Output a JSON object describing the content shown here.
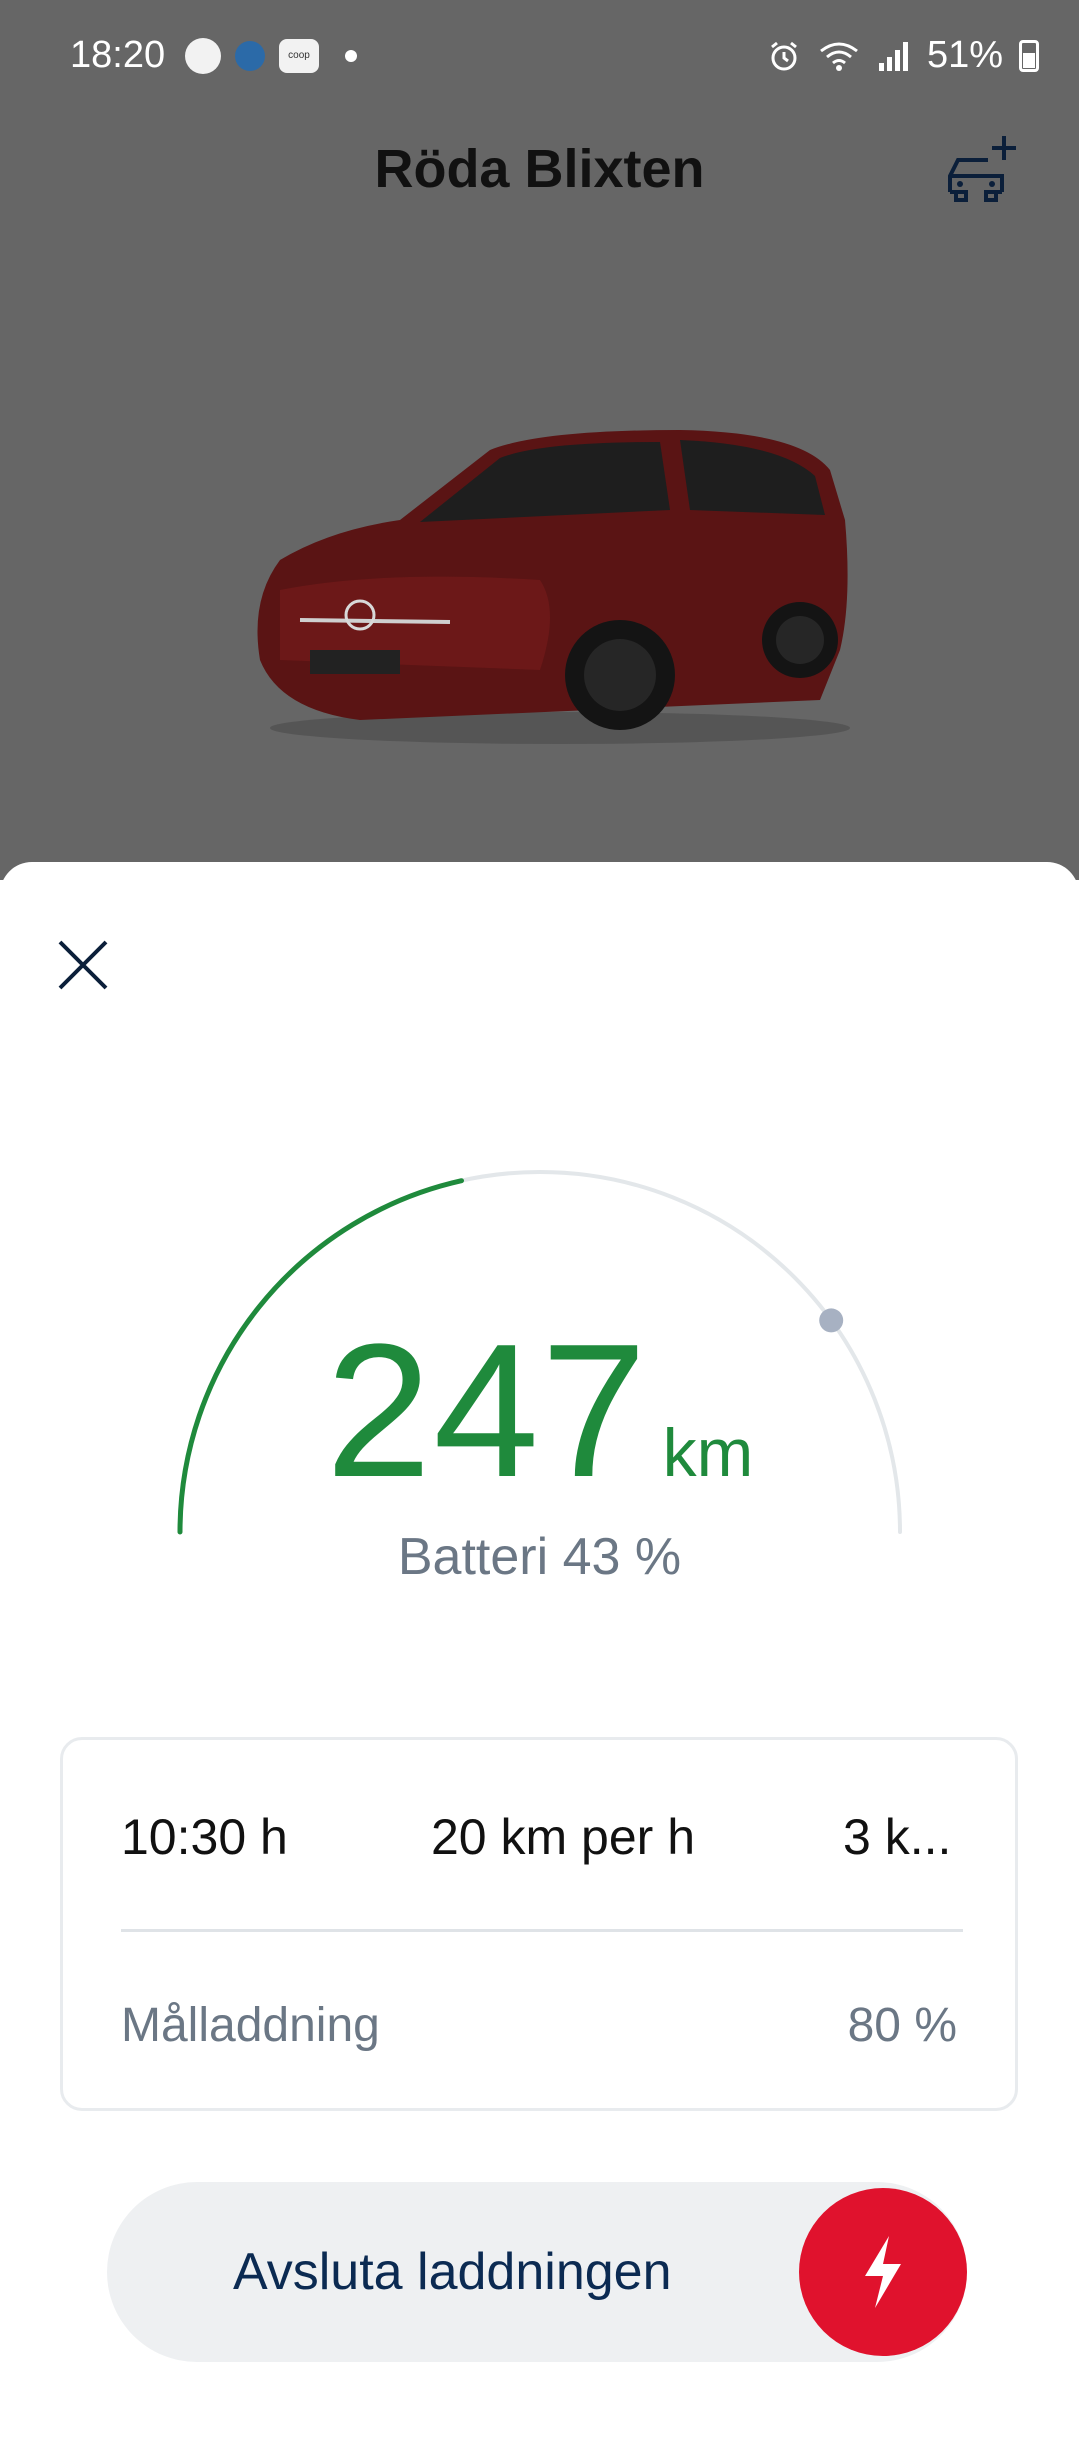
{
  "status_bar": {
    "time": "18:20",
    "battery_percent": "51%",
    "coop_label": "coop"
  },
  "header": {
    "car_name": "Röda Blixten"
  },
  "charging": {
    "range_value": "247",
    "range_unit": "km",
    "battery_label": "Batteri 43 %",
    "battery_level": 0.43,
    "target_level": 0.8,
    "time_remaining": "10:30 h",
    "charging_speed": "20 km per h",
    "third_stat": "3 k...",
    "target_label": "Målladdning",
    "target_value": "80 %",
    "stop_button_label": "Avsluta laddningen"
  },
  "colors": {
    "range_green": "#1f8a3c",
    "stop_red": "#e0122d",
    "dim_overlay": "#666666"
  }
}
